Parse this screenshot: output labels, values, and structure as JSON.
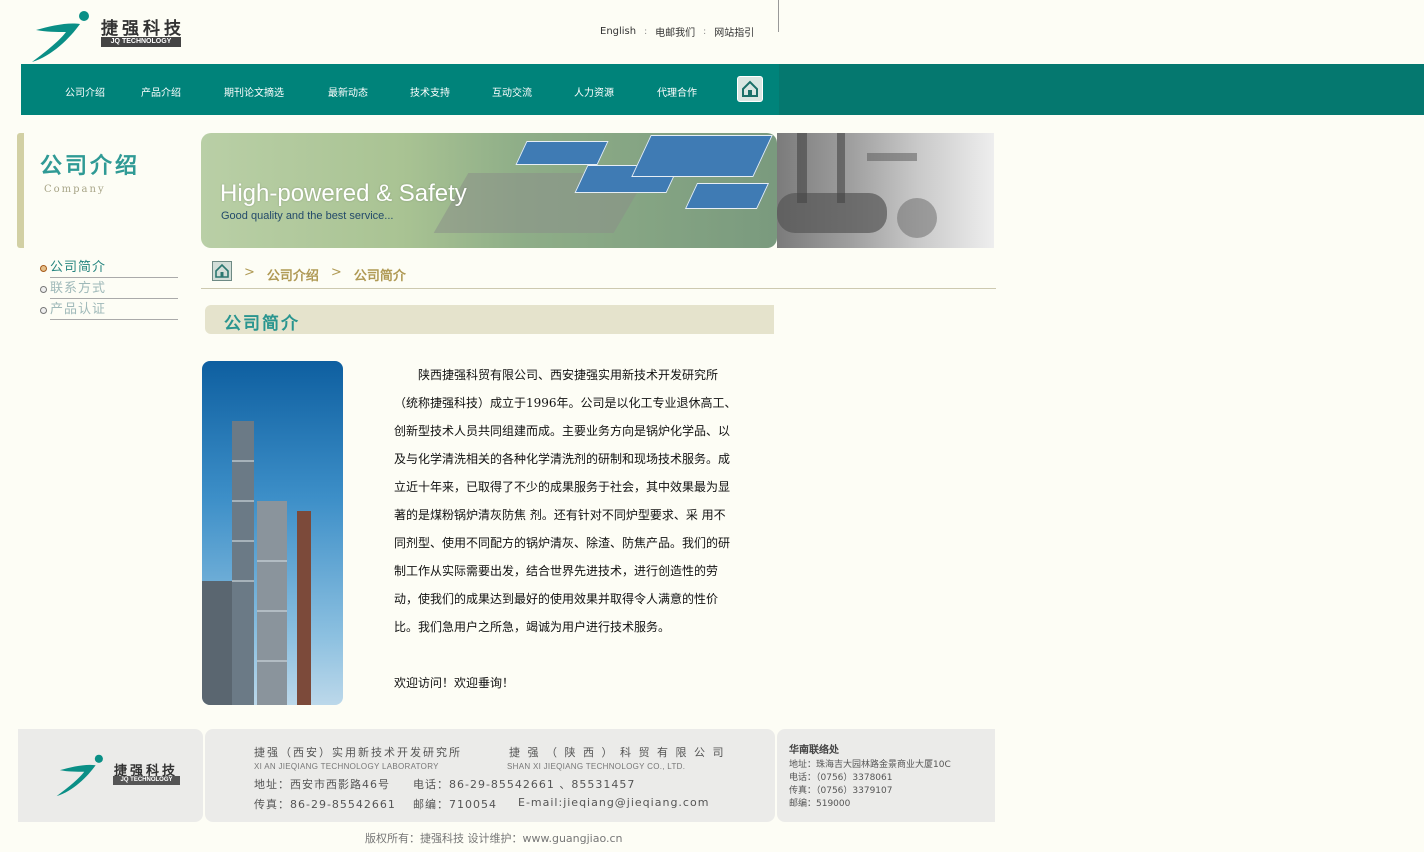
{
  "brand": {
    "name_cn": "捷强科技",
    "name_en": "JQ TECHNOLOGY"
  },
  "top_links": [
    "English",
    "电邮我们",
    "网站指引"
  ],
  "nav": {
    "items": [
      "公司介绍",
      "产品介绍",
      "期刊论文摘选",
      "最新动态",
      "技术支持",
      "互动交流",
      "人力资源",
      "代理合作"
    ],
    "home_icon": "home-icon"
  },
  "section": {
    "title": "公司介绍",
    "subtitle": "Company"
  },
  "side_menu": {
    "items": [
      {
        "label": "公司简介",
        "active": true
      },
      {
        "label": "联系方式",
        "active": false
      },
      {
        "label": "产品认证",
        "active": false
      }
    ]
  },
  "banner": {
    "title": "High-powered & Safety",
    "subtitle": "Good quality and the best service..."
  },
  "breadcrumb": [
    "公司介绍",
    "公司简介"
  ],
  "content": {
    "title": "公司简介",
    "lines": [
      "　　陕西捷强科贸有限公司、西安捷强实用新技术开发研究所",
      "（统称捷强科技）成立于1996年。公司是以化工专业退休高工、",
      "创新型技术人员共同组建而成。主要业务方向是锅炉化学品、以",
      "及与化学清洗相关的各种化学清洗剂的研制和现场技术服务。成",
      "立近十年来，已取得了不少的成果服务于社会，其中效果最为显",
      "著的是煤粉锅炉清灰防焦 剂。还有针对不同炉型要求、采 用不",
      "同剂型、使用不同配方的锅炉清灰、除渣、防焦产品。我们的研",
      "制工作从实际需要出发，结合世界先进技术，进行创造性的劳",
      "动，使我们的成果达到最好的使用效果并取得令人满意的性价",
      "比。我们急用户之所急，竭诚为用户进行技术服务。"
    ],
    "welcome": "欢迎访问！欢迎垂询！"
  },
  "footer": {
    "org1_cn": "捷强（西安）实用新技术开发研究所",
    "org1_en": "XI AN JIEQIANG TECHNOLOGY LABORATORY",
    "org2_cn": "捷 强 （ 陕 西 ） 科 贸 有 限 公 司",
    "org2_en": "SHAN XI JIEQIANG TECHNOLOGY CO., LTD.",
    "address": "地址：西安市西影路46号",
    "phone": "电话：86-29-85542661 、85531457",
    "fax": "传真：86-29-85542661",
    "postcode": "邮编：710054",
    "email": "E-mail:jieqiang@jieqiang.com",
    "south": {
      "title": "华南联络处",
      "address": "地址：珠海吉大园林路金景商业大厦10C",
      "phone": "电话：（0756）3378061",
      "fax": "传真：（0756）3379107",
      "postcode": "邮编：519000"
    },
    "copyright": "版权所有：捷强科技 设计维护：www.guangjiao.cn"
  },
  "colors": {
    "nav_bg": "#00837a",
    "accent": "#2a958f",
    "breadcrumb": "#b09a55",
    "footer_bg": "#ebebe9"
  }
}
